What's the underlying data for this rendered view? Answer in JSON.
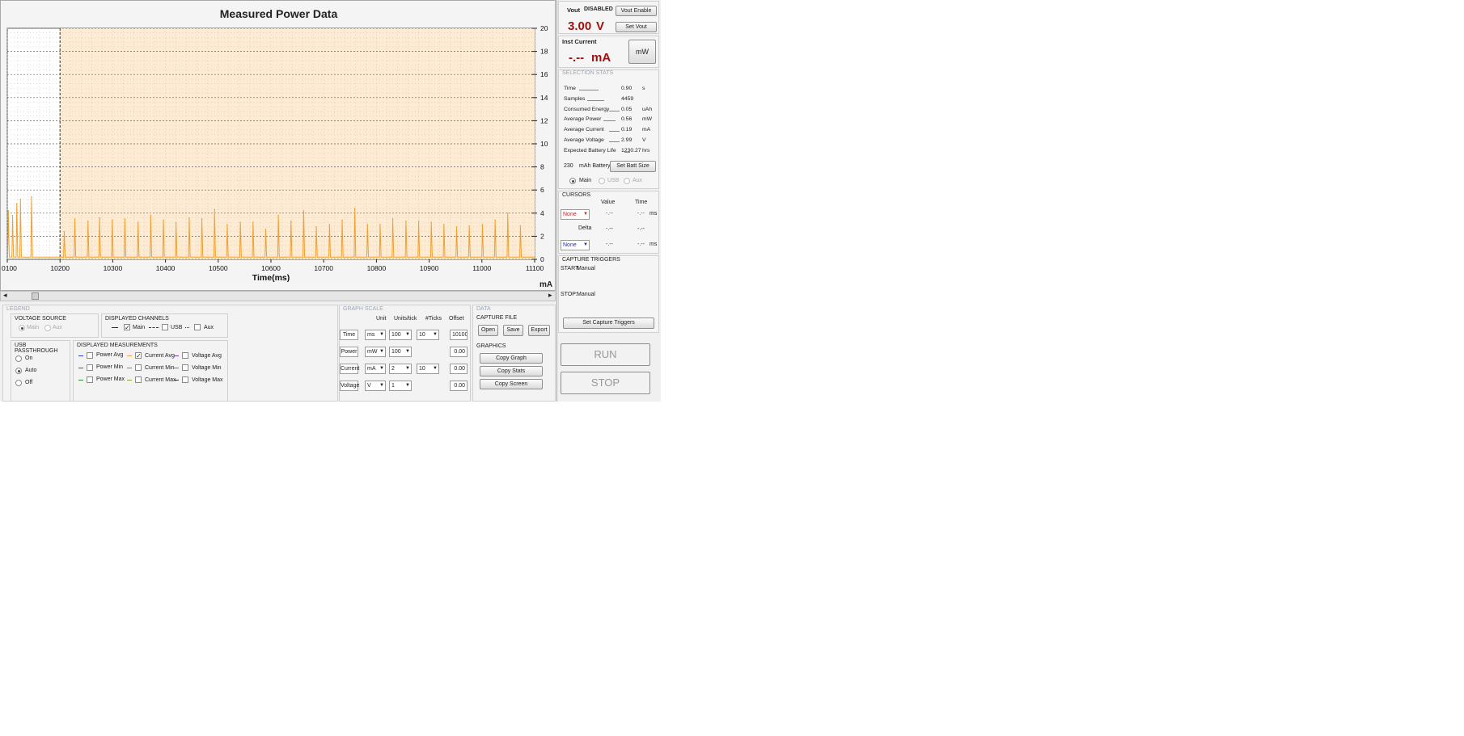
{
  "chart": {
    "title": "Measured Power Data",
    "x_label": "Time(ms)",
    "y_unit": "mA",
    "scroll_left": "◂",
    "scroll_right": "▸"
  },
  "chart_data": {
    "type": "line",
    "x_ticks": [
      "0100",
      "10200",
      "10300",
      "10400",
      "10500",
      "10600",
      "10700",
      "10800",
      "10900",
      "11000",
      "11100"
    ],
    "y_ticks": [
      "0",
      "2",
      "4",
      "6",
      "8",
      "10",
      "12",
      "14",
      "16",
      "18",
      "20"
    ],
    "xlim": [
      10100,
      11100
    ],
    "ylim": [
      0,
      20
    ],
    "selection_range": [
      10200,
      11100
    ],
    "series": [
      {
        "channel": "Main",
        "color": "#f0a030",
        "spike_times": [
          10102,
          10110,
          10118,
          10125,
          10146,
          10208,
          10228,
          10253,
          10275,
          10299,
          10323,
          10348,
          10372,
          10396,
          10420,
          10445,
          10469,
          10493,
          10517,
          10542,
          10566,
          10590,
          10614,
          10638,
          10662,
          10686,
          10711,
          10735,
          10759,
          10783,
          10807,
          10831,
          10856,
          10880,
          10904,
          10928,
          10952,
          10976,
          11001,
          11025,
          11049,
          11073
        ],
        "spike_peaks": [
          4.2,
          3.8,
          4.8,
          5.2,
          5.4,
          2.4,
          3.5,
          3.3,
          3.6,
          3.4,
          3.5,
          3.2,
          3.8,
          3.4,
          3.2,
          3.6,
          3.5,
          4.3,
          3.0,
          3.2,
          3.2,
          2.6,
          3.8,
          3.3,
          4.2,
          2.8,
          3.0,
          3.4,
          4.4,
          3.0,
          3.0,
          3.5,
          3.3,
          3.3,
          3.2,
          3.0,
          2.8,
          2.9,
          3.0,
          3.4,
          4.0,
          2.9
        ],
        "baseline": 0.19
      }
    ]
  },
  "legend": {
    "section": "LEGEND",
    "voltage_source": {
      "title": "VOLTAGE SOURCE",
      "options": [
        "Main",
        "Aux"
      ]
    },
    "channels": {
      "title": "DISPLAYED CHANNELS",
      "main": "Main",
      "usb": "USB",
      "aux": "Aux"
    },
    "usb_passthrough": {
      "title": "USB PASSTHROUGH",
      "options": [
        "On",
        "Auto",
        "Off"
      ]
    },
    "measurements": {
      "title": "DISPLAYED MEASUREMENTS",
      "power": [
        "Power Avg",
        "Power Min",
        "Power Max"
      ],
      "current": [
        "Current Avg",
        "Current Min",
        "Current Max"
      ],
      "voltage": [
        "Voltage Avg",
        "Voltage Min",
        "Voltage Max"
      ]
    }
  },
  "graph_scale": {
    "section": "GRAPH SCALE",
    "headers": [
      "Unit",
      "Units/tick",
      "#Ticks",
      "Offset"
    ],
    "rows": [
      {
        "label": "Time",
        "unit": "ms",
        "per_tick": "100",
        "ticks": "10",
        "offset": "10100"
      },
      {
        "label": "Power",
        "unit": "mW",
        "per_tick": "100",
        "ticks": "",
        "offset": "0.00"
      },
      {
        "label": "Current",
        "unit": "mA",
        "per_tick": "2",
        "ticks": "10",
        "offset": "0.00"
      },
      {
        "label": "Voltage",
        "unit": "V",
        "per_tick": "1",
        "ticks": "",
        "offset": "0.00"
      }
    ]
  },
  "data_panel": {
    "section": "DATA",
    "capture_file": "CAPTURE FILE",
    "open": "Open",
    "save": "Save",
    "export": "Export",
    "graphics": "GRAPHICS",
    "copy_graph": "Copy Graph",
    "copy_stats": "Copy Stats",
    "copy_screen": "Copy Screen"
  },
  "vout": {
    "label": "Vout",
    "status": "DISABLED",
    "value": "3.00",
    "unit": "V",
    "enable_btn": "Vout Enable",
    "set_btn": "Set Vout"
  },
  "inst_current": {
    "label": "Inst Current",
    "value": "-.--",
    "unit": "mA",
    "toggle": "mW"
  },
  "selection_stats": {
    "section": "SELECTION STATS",
    "rows": [
      {
        "name": "Time",
        "value": "0.90",
        "unit": "s"
      },
      {
        "name": "Samples",
        "value": "4459",
        "unit": ""
      },
      {
        "name": "Consumed Energy",
        "value": "0.05",
        "unit": "uAh"
      },
      {
        "name": "Average Power",
        "value": "0.56",
        "unit": "mW"
      },
      {
        "name": "Average Current",
        "value": "0.19",
        "unit": "mA"
      },
      {
        "name": "Average Voltage",
        "value": "2.99",
        "unit": "V"
      },
      {
        "name": "Expected Battery Life",
        "value": "1230.27",
        "unit": "hrs"
      }
    ],
    "battery_value": "230",
    "battery_label": "mAh Battery",
    "set_batt": "Set Batt Size",
    "sources": [
      "Main",
      "USB",
      "Aux"
    ]
  },
  "cursors": {
    "section": "CURSORS",
    "value_header": "Value",
    "time_header": "Time",
    "c1_select": "None",
    "c1_value": "-.--",
    "c1_time": "-.--",
    "c1_unit": "ms",
    "delta_label": "Delta",
    "delta_value": "-.--",
    "delta_time": "-.--",
    "c2_select": "None",
    "c2_value": "-.--",
    "c2_time": "-.--",
    "c2_unit": "ms"
  },
  "triggers": {
    "section": "CAPTURE TRIGGERS",
    "start_label": "START:",
    "start_value": "Manual",
    "stop_label": "STOP:",
    "stop_value": "Manual",
    "set_btn": "Set Capture Triggers"
  },
  "run_btn": "RUN",
  "stop_btn": "STOP",
  "colors": {
    "orange": "#f0a030",
    "shade": "#fdebd3",
    "red": "#a01010",
    "blue": "#2030a0"
  }
}
